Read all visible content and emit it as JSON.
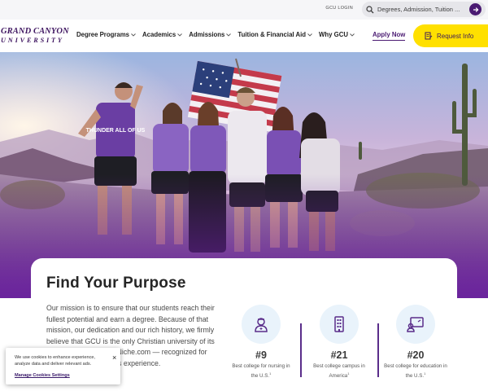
{
  "header": {
    "login_label": "GCU LOGIN",
    "search_placeholder": "Degrees, Admission, Tuition ...",
    "logo": {
      "line1": "GRAND CANYON",
      "line2": "UNIVERSITY"
    },
    "menu": [
      {
        "label": "Degree Programs"
      },
      {
        "label": "Academics"
      },
      {
        "label": "Admissions"
      },
      {
        "label": "Tuition & Financial Aid"
      },
      {
        "label": "Why GCU"
      }
    ],
    "apply_label": "Apply Now",
    "request_label": "Request Info"
  },
  "hero": {
    "shirt_text": "THUNDER ALL OF US"
  },
  "purpose": {
    "title": "Find Your Purpose",
    "paragraph": "Our mission is to ensure that our students reach their fullest potential and earn a degree. Because of that mission, our dedication and our rich history, we firmly believe that GCU is the only Christian university of its kind. ... rankings from Niche.com — recognized for academics and campus experience."
  },
  "stats": [
    {
      "icon": "nurse-icon",
      "number": "#9",
      "desc": "Best college for nursing in the U.S.",
      "mark": "1"
    },
    {
      "icon": "building-icon",
      "number": "#21",
      "desc": "Best college campus in America",
      "mark": "1"
    },
    {
      "icon": "teacher-icon",
      "number": "#20",
      "desc": "Best college for education in the U.S.",
      "mark": "1"
    }
  ],
  "cookie": {
    "message": "We use cookies to enhance experience, analyze data and deliver relevant ads.",
    "manage_label": "Manage Cookies Settings",
    "close_symbol": "×"
  },
  "colors": {
    "brand_purple": "#4a1a72",
    "accent_yellow": "#ffe000",
    "stat_circle": "#e9f3fb"
  }
}
